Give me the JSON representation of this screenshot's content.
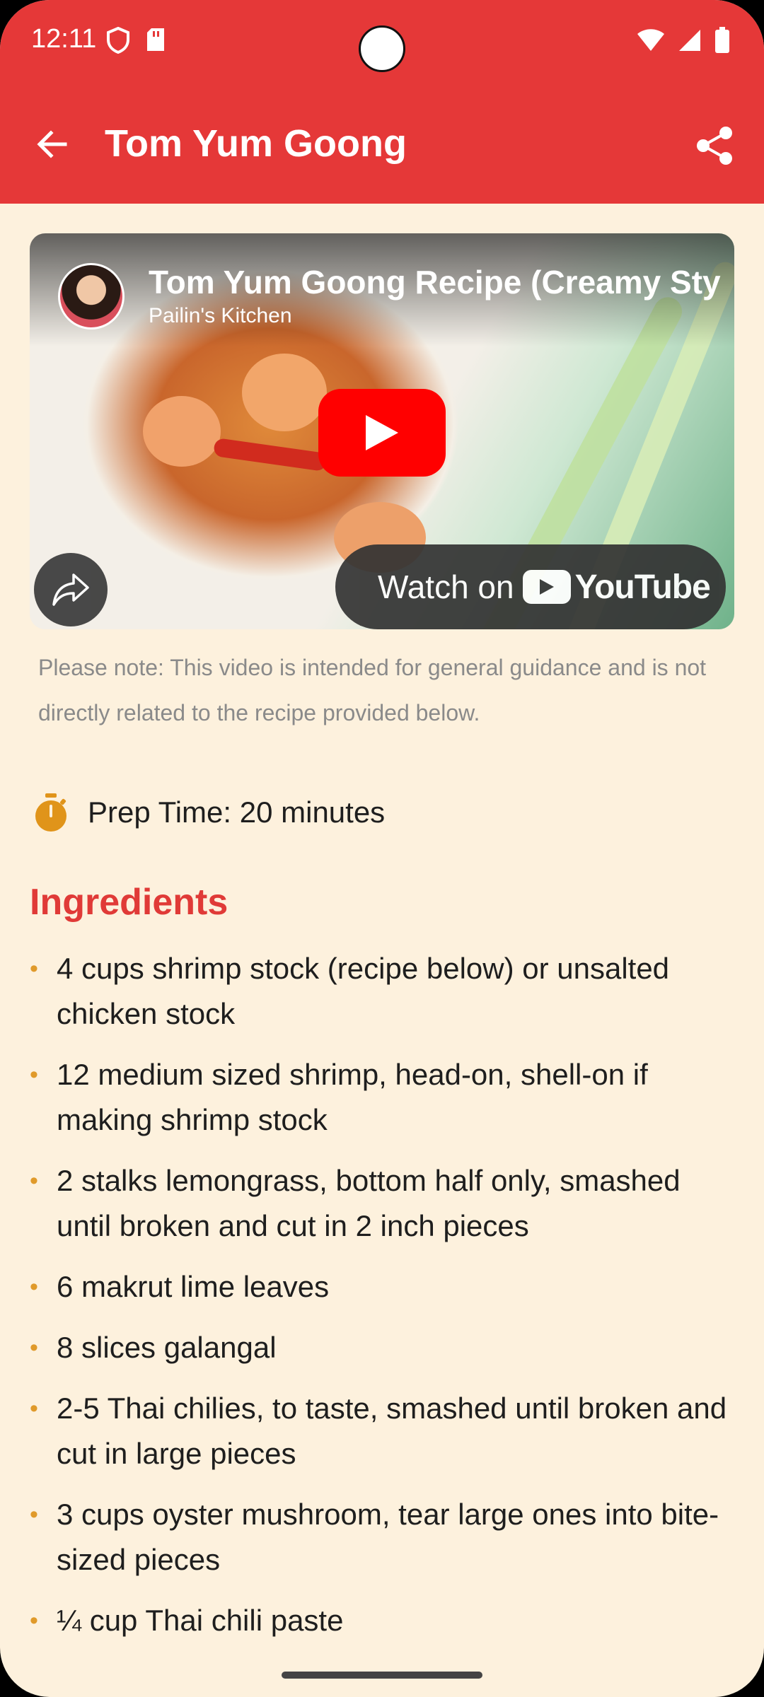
{
  "status_bar": {
    "time": "12:11"
  },
  "app_bar": {
    "title": "Tom Yum Goong",
    "back_icon": "arrow-left-icon",
    "share_icon": "share-icon"
  },
  "video": {
    "title": "Tom Yum Goong Recipe (Creamy Style",
    "channel": "Pailin's Kitchen",
    "watch_on": "Watch on",
    "youtube_word": "YouTube",
    "play_icon": "play-icon"
  },
  "note": "Please note: This video is intended for general guidance and is not directly related to the recipe provided below.",
  "prep": {
    "icon": "timer-icon",
    "label": "Prep Time: 20 minutes"
  },
  "ingredients": {
    "title": "Ingredients",
    "items": [
      "4 cups shrimp stock (recipe below) or unsalted chicken stock",
      "12 medium sized shrimp, head-on, shell-on if making shrimp stock",
      "2 stalks lemongrass, bottom half only, smashed until broken and cut in 2 inch pieces",
      "6 makrut lime leaves",
      "8 slices galangal",
      "2-5 Thai chilies, to taste, smashed until broken and cut in large pieces",
      "3 cups oyster mushroom, tear large ones into bite-sized pieces",
      "¼ cup Thai chili paste"
    ]
  },
  "colors": {
    "primary": "#e53838",
    "background": "#fdf1dd",
    "accent": "#e09a2a"
  }
}
